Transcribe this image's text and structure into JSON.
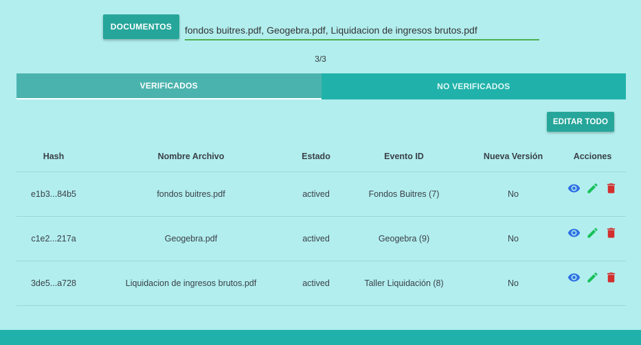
{
  "upload": {
    "button_label": "DOCUMENTOS",
    "files_value": "fondos buitres.pdf, Geogebra.pdf, Liquidacion de ingresos brutos.pdf"
  },
  "pager": {
    "text": "3/3"
  },
  "tabs": [
    {
      "label": "VERIFICADOS",
      "active": true
    },
    {
      "label": "NO VERIFICADOS",
      "active": false
    }
  ],
  "toolbar": {
    "edit_all_label": "EDITAR TODO"
  },
  "table": {
    "headers": [
      "Hash",
      "Nombre Archivo",
      "Estado",
      "Evento ID",
      "Nueva Versión",
      "Acciones"
    ],
    "rows": [
      {
        "hash": "e1b3...84b5",
        "name": "fondos buitres.pdf",
        "status": "actived",
        "event": "Fondos Buitres (7)",
        "new_version": "No"
      },
      {
        "hash": "c1e2...217a",
        "name": "Geogebra.pdf",
        "status": "actived",
        "event": "Geogebra (9)",
        "new_version": "No"
      },
      {
        "hash": "3de5...a728",
        "name": "Liquidacion de ingresos brutos.pdf",
        "status": "actived",
        "event": "Taller Liquidación (8)",
        "new_version": "No"
      }
    ],
    "actions": [
      {
        "icon": "eye-icon",
        "color": "#2f6fe4"
      },
      {
        "icon": "pencil-icon",
        "color": "#19c05a"
      },
      {
        "icon": "trash-icon",
        "color": "#d32f2f"
      }
    ]
  },
  "colors": {
    "background": "#b2eeee",
    "teal": "#26a69a",
    "tab_inactive": "#20b2aa",
    "tab_active": "#4bb3ad",
    "input_underline": "#4caf50"
  }
}
